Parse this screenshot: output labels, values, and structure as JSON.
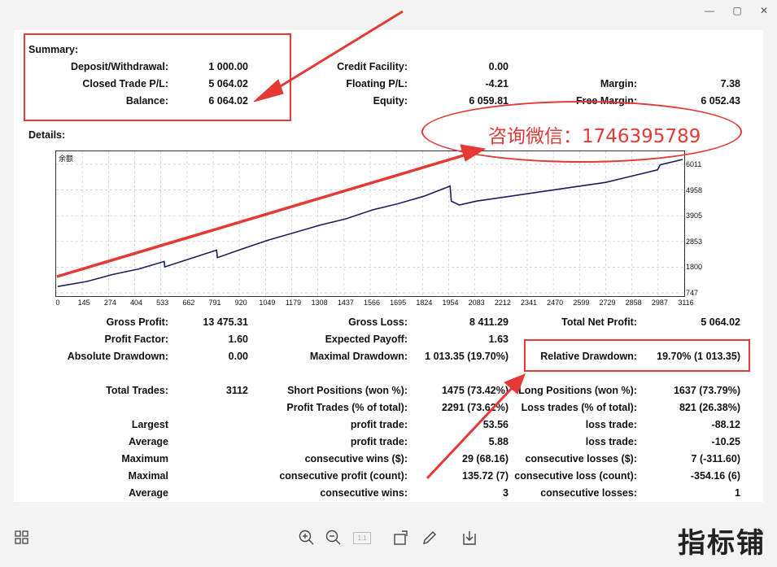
{
  "window": {
    "minimize": "—",
    "maximize": "▢",
    "close": "✕"
  },
  "summary": {
    "title": "Summary:",
    "deposit_label": "Deposit/Withdrawal:",
    "deposit": "1 000.00",
    "closed_label": "Closed Trade P/L:",
    "closed": "5 064.02",
    "balance_label": "Balance:",
    "balance": "6 064.02",
    "credit_label": "Credit Facility:",
    "credit": "0.00",
    "floating_label": "Floating P/L:",
    "floating": "-4.21",
    "equity_label": "Equity:",
    "equity": "6 059.81",
    "margin_label": "Margin:",
    "margin": "7.38",
    "free_margin_label": "Free Margin:",
    "free_margin": "6 052.43"
  },
  "details_title": "Details:",
  "annotation": {
    "contact": "咨询微信：1746395789"
  },
  "chart_data": {
    "type": "line",
    "title": "余额",
    "x_ticks": [
      "0",
      "145",
      "274",
      "404",
      "533",
      "662",
      "791",
      "920",
      "1049",
      "1179",
      "1308",
      "1437",
      "1566",
      "1695",
      "1824",
      "1954",
      "2083",
      "2212",
      "2341",
      "2470",
      "2599",
      "2729",
      "2858",
      "2987",
      "3116"
    ],
    "y_ticks": [
      "6011",
      "4958",
      "3905",
      "2853",
      "1800",
      "747"
    ],
    "xlim": [
      0,
      3112
    ],
    "ylim": [
      747,
      6064
    ],
    "series": [
      {
        "x": [
          0,
          145,
          274,
          404,
          530,
          533,
          662,
          791,
          795,
          920,
          1049,
          1179,
          1308,
          1437,
          1566,
          1695,
          1824,
          1954,
          1960,
          2000,
          2083,
          2212,
          2341,
          2470,
          2599,
          2729,
          2858,
          2987,
          3000,
          3112
        ],
        "y": [
          1000,
          1200,
          1480,
          1700,
          2000,
          1780,
          2120,
          2450,
          2150,
          2500,
          2850,
          3150,
          3450,
          3700,
          4050,
          4300,
          4600,
          5000,
          4400,
          4250,
          4400,
          4550,
          4700,
          4850,
          5000,
          5150,
          5400,
          5650,
          5850,
          6064
        ]
      }
    ]
  },
  "stats": {
    "gross_profit_label": "Gross Profit:",
    "gross_profit": "13 475.31",
    "profit_factor_label": "Profit Factor:",
    "profit_factor": "1.60",
    "abs_dd_label": "Absolute Drawdown:",
    "abs_dd": "0.00",
    "gross_loss_label": "Gross Loss:",
    "gross_loss": "8 411.29",
    "expected_payoff_label": "Expected Payoff:",
    "expected_payoff": "1.63",
    "max_dd_label": "Maximal Drawdown:",
    "max_dd": "1 013.35 (19.70%)",
    "total_net_label": "Total Net Profit:",
    "total_net": "5 064.02",
    "rel_dd_label": "Relative Drawdown:",
    "rel_dd": "19.70% (1 013.35)",
    "total_trades_label": "Total Trades:",
    "total_trades": "3112",
    "short_label": "Short Positions (won %):",
    "short": "1475 (73.42%)",
    "profit_trades_label": "Profit Trades (% of total):",
    "profit_trades": "2291 (73.62%)",
    "long_label": "Long Positions (won %):",
    "long": "1637 (73.79%)",
    "loss_trades_label": "Loss trades (% of total):",
    "loss_trades": "821 (26.38%)",
    "largest_label": "Largest",
    "largest_profit_label": "profit trade:",
    "largest_profit": "53.56",
    "largest_loss_label": "loss trade:",
    "largest_loss": "-88.12",
    "average_label": "Average",
    "average_profit_label": "profit trade:",
    "average_profit": "5.88",
    "average_loss_label": "loss trade:",
    "average_loss": "-10.25",
    "maximum_label": "Maximum",
    "max_wins_label": "consecutive wins ($):",
    "max_wins": "29 (68.16)",
    "max_losses_label": "consecutive losses ($):",
    "max_losses": "7 (-311.60)",
    "maximal_label": "Maximal",
    "maximal_profit_label": "consecutive profit (count):",
    "maximal_profit": "135.72 (7)",
    "maximal_loss_label": "consecutive loss (count):",
    "maximal_loss": "-354.16 (6)",
    "average2_label": "Average",
    "avg_cons_wins_label": "consecutive wins:",
    "avg_cons_wins": "3",
    "avg_cons_losses_label": "consecutive losses:",
    "avg_cons_losses": "1"
  },
  "toolbar": {
    "zoom_box": "1:1"
  },
  "watermark": "指标铺"
}
